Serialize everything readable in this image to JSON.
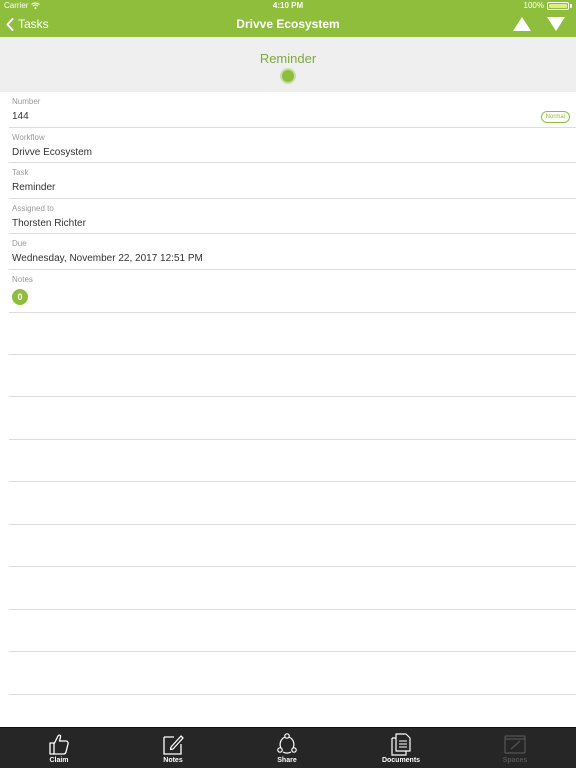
{
  "status_bar": {
    "carrier": "Carrier",
    "time": "4:10 PM",
    "battery": "100%"
  },
  "navbar": {
    "back_label": "Tasks",
    "title": "Drivve Ecosystem"
  },
  "header": {
    "title": "Reminder"
  },
  "fields": {
    "number": {
      "label": "Number",
      "value": "144",
      "badge": "Normal"
    },
    "workflow": {
      "label": "Workflow",
      "value": "Drivve Ecosystem"
    },
    "task": {
      "label": "Task",
      "value": "Reminder"
    },
    "assigned_to": {
      "label": "Assigned to",
      "value": "Thorsten Richter"
    },
    "due": {
      "label": "Due",
      "value": "Wednesday, November 22, 2017 12:51 PM"
    },
    "notes": {
      "label": "Notes",
      "count": "0"
    }
  },
  "tabbar": {
    "claim": "Claim",
    "notes": "Notes",
    "share": "Share",
    "documents": "Documents",
    "spaces": "Spaces"
  },
  "colors": {
    "accent": "#8fbe3c",
    "tabbar": "#262626",
    "header_band": "#efefef"
  },
  "icons": [
    "wifi-icon",
    "battery-icon",
    "chevron-left-icon",
    "triangle-up-icon",
    "triangle-down-icon",
    "thumbs-up-icon",
    "edit-icon",
    "share-icon",
    "documents-icon",
    "spaces-icon"
  ]
}
